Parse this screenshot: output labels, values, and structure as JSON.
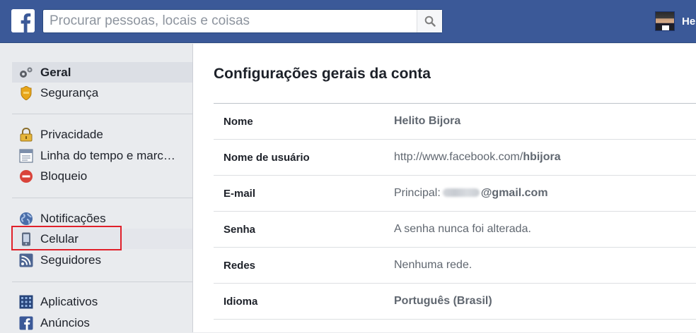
{
  "topbar": {
    "logo_letter": "f",
    "search_placeholder": "Procurar pessoas, locais e coisas",
    "profile_name": "He",
    "brand_color": "#3b5998"
  },
  "sidebar": {
    "items": [
      {
        "label": "Geral",
        "icon": "gears-icon",
        "active": true
      },
      {
        "label": "Segurança",
        "icon": "security-badge-icon"
      },
      {
        "label": "Privacidade",
        "icon": "privacy-lock-icon"
      },
      {
        "label": "Linha do tempo e marc…",
        "icon": "timeline-icon"
      },
      {
        "label": "Bloqueio",
        "icon": "block-icon"
      },
      {
        "label": "Notificações",
        "icon": "globe-icon"
      },
      {
        "label": "Celular",
        "icon": "mobile-phone-icon",
        "highlighted": true
      },
      {
        "label": "Seguidores",
        "icon": "rss-icon"
      },
      {
        "label": "Aplicativos",
        "icon": "apps-icon"
      },
      {
        "label": "Anúncios",
        "icon": "ads-icon"
      }
    ],
    "highlight_color": "#e0202a"
  },
  "main": {
    "title": "Configurações gerais da conta",
    "rows": [
      {
        "label": "Nome",
        "value": "Helito Bijora"
      },
      {
        "label": "Nome de usuário",
        "value_prefix": "http://www.facebook.com/",
        "value_bold": "hbijora"
      },
      {
        "label": "E-mail",
        "value_prefix": "Principal:",
        "value_bold": "@gmail.com"
      },
      {
        "label": "Senha",
        "value": "A senha nunca foi alterada."
      },
      {
        "label": "Redes",
        "value": "Nenhuma rede."
      },
      {
        "label": "Idioma",
        "value": "Português (Brasil)"
      }
    ]
  }
}
